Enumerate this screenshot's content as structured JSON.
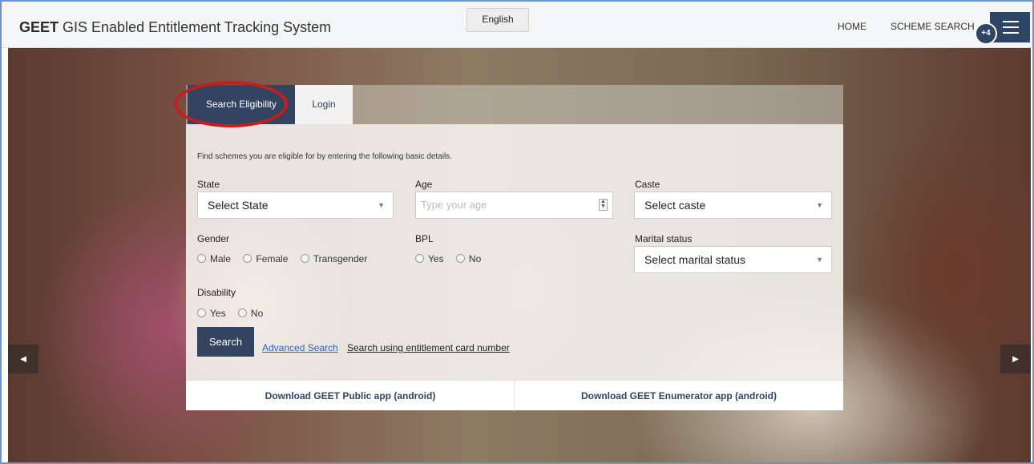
{
  "header": {
    "brand_bold": "GEET",
    "brand_rest": " GIS Enabled Entitlement Tracking System",
    "language": "English",
    "nav": [
      "HOME",
      "SCHEME SEARCH"
    ],
    "badge": "+4"
  },
  "tabs": {
    "active": "Search Eligibility",
    "other": "Login"
  },
  "form": {
    "intro": "Find schemes you are eligible for by entering the following basic details.",
    "state": {
      "label": "State",
      "value": "Select State"
    },
    "age": {
      "label": "Age",
      "placeholder": "Type your age"
    },
    "caste": {
      "label": "Caste",
      "value": "Select caste"
    },
    "gender": {
      "label": "Gender",
      "options": [
        "Male",
        "Female",
        "Transgender"
      ]
    },
    "bpl": {
      "label": "BPL",
      "options": [
        "Yes",
        "No"
      ]
    },
    "marital": {
      "label": "Marital status",
      "value": "Select marital status"
    },
    "disability": {
      "label": "Disability",
      "options": [
        "Yes",
        "No"
      ]
    },
    "search_button": "Search",
    "advanced_link": "Advanced Search",
    "card_link": "Search using entitlement card number"
  },
  "downloads": {
    "public": "Download GEET Public app (android)",
    "enumerator": "Download GEET Enumerator app (android)"
  },
  "carousel": {
    "prev": "◄",
    "next": "►"
  },
  "colors": {
    "accent": "#34435f",
    "highlight": "#c41e1e",
    "link": "#3162b3"
  }
}
